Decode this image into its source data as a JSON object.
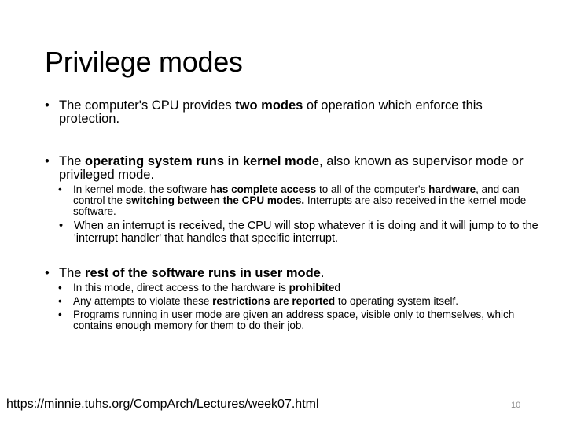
{
  "title": "Privilege modes",
  "bullets": {
    "b1": {
      "p1": "The computer's CPU provides ",
      "bold": "two modes",
      "p2": " of operation which enforce this protection."
    },
    "b2": {
      "p1": "The ",
      "bold": "operating system runs in kernel mode",
      "p2": ", also known as supervisor mode or privileged mode.",
      "sub1": {
        "p1": "In kernel mode, the software ",
        "bold1": "has complete access",
        "p2": " to all of the computer's ",
        "bold2": "hardware",
        "p3": ", and can control the ",
        "bold3": "switching between the CPU modes.",
        "p4": " Interrupts are also received in the kernel mode software.",
        "sub1": "When an interrupt is received, the CPU will stop whatever it is doing and it will jump to to the 'interrupt handler' that handles that specific interrupt."
      }
    },
    "b3": {
      "p1": "The ",
      "bold": "rest of the software runs in user mode",
      "p2": ".",
      "sub1": {
        "p1": "In this mode, direct access to the hardware is ",
        "bold": "prohibited"
      },
      "sub2": {
        "p1": "Any attempts to violate these ",
        "bold": "restrictions are reported",
        "p2": " to operating system itself."
      },
      "sub3": "Programs running in user mode are given an address space, visible only to themselves, which contains enough memory for them to do their job."
    }
  },
  "footer": {
    "url": "https://minnie.tuhs.org/CompArch/Lectures/week07.html",
    "page_number": "10"
  }
}
